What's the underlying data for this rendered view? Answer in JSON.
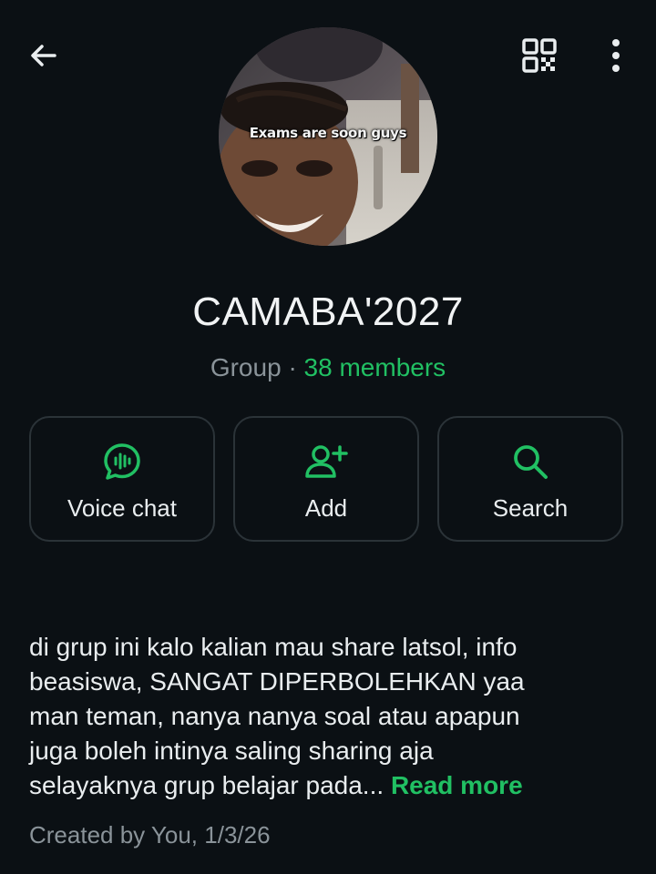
{
  "header": {
    "back_icon": "arrow-left-icon",
    "qr_icon": "qr-code-icon",
    "more_icon": "more-vertical-icon"
  },
  "avatar": {
    "caption": "Exams are soon guys"
  },
  "group": {
    "name": "CAMABA'2027",
    "type_label": "Group",
    "separator": "·",
    "members_label": "38 members"
  },
  "actions": [
    {
      "label": "Voice chat",
      "icon": "voice-chat-icon"
    },
    {
      "label": "Add",
      "icon": "add-person-icon"
    },
    {
      "label": "Search",
      "icon": "search-icon"
    }
  ],
  "description": {
    "lines": [
      "di grup ini kalo kalian mau share latsol, info",
      "beasiswa, SANGAT DIPERBOLEHKAN yaa",
      "man teman, nanya nanya soal atau apapun",
      "juga boleh intinya saling sharing aja",
      "selayaknya grup belajar pada..."
    ],
    "read_more": "Read more"
  },
  "created_text": "Created by You, 1/3/26",
  "colors": {
    "background": "#0b1014",
    "accent": "#21c063",
    "text_primary": "#e9edef",
    "text_secondary": "#8a9399",
    "card_border": "#2b3338"
  }
}
